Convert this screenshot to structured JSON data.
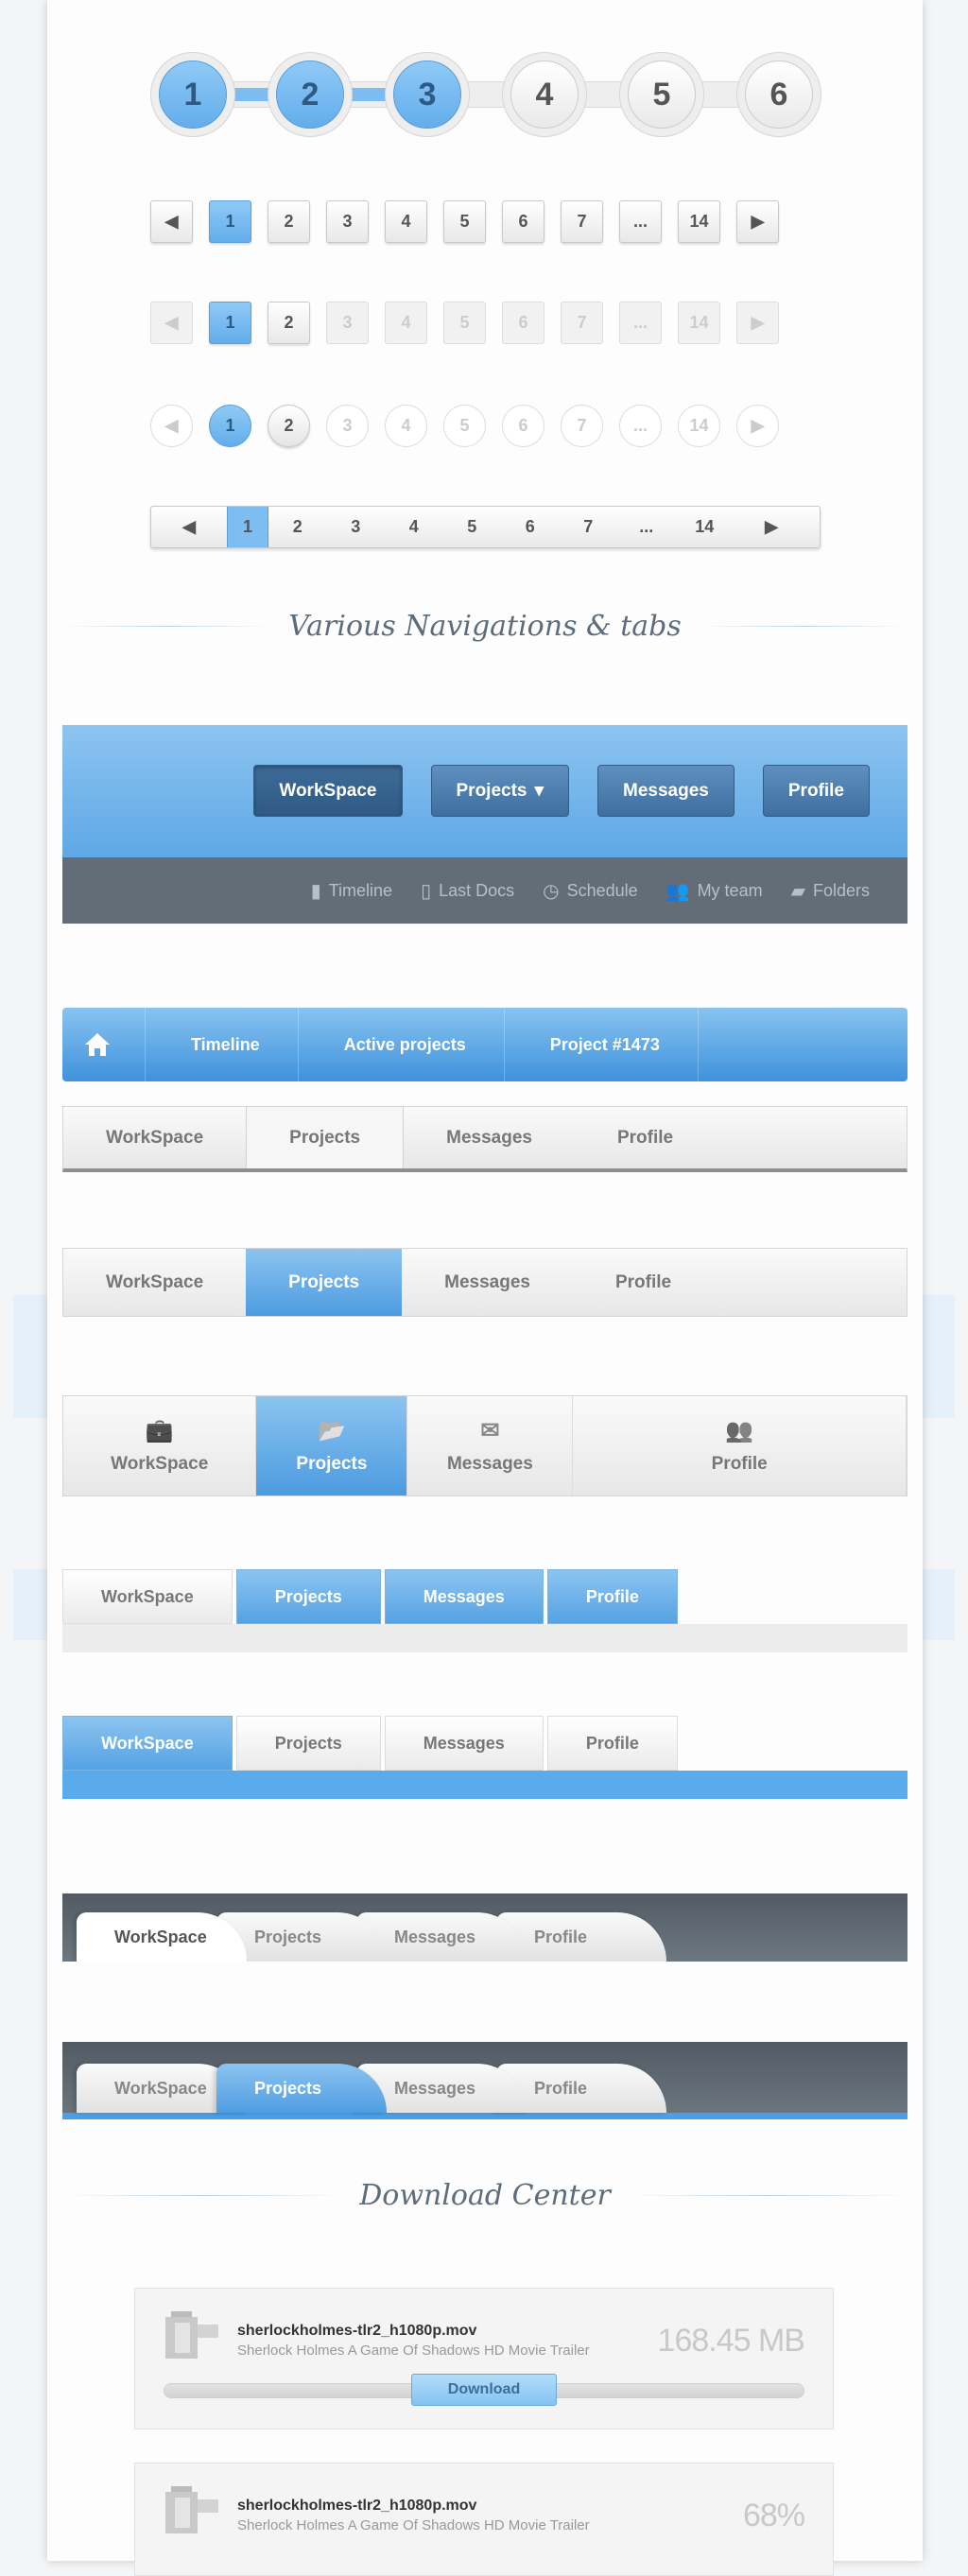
{
  "colors": {
    "accent": "#63adeb",
    "dark_bar": "#636d77",
    "text": "#555555"
  },
  "steps": {
    "items": [
      "1",
      "2",
      "3",
      "4",
      "5",
      "6"
    ],
    "completed": 3
  },
  "pagination": {
    "prev_icon": "triangle-left-icon",
    "next_icon": "triangle-right-icon",
    "prev": "◀",
    "next": "▶",
    "pages": [
      "1",
      "2",
      "3",
      "4",
      "5",
      "6",
      "7",
      "...",
      "14"
    ],
    "active": "1"
  },
  "section_nav": {
    "title": "Various Navigations & tabs"
  },
  "topnav": {
    "buttons": [
      "WorkSpace",
      "Projects",
      "Messages",
      "Profile"
    ],
    "dropdown_icon": "▾",
    "subitems": [
      {
        "label": "Timeline",
        "icon": "bar-chart-icon"
      },
      {
        "label": "Last Docs",
        "icon": "document-icon"
      },
      {
        "label": "Schedule",
        "icon": "clock-icon"
      },
      {
        "label": "My team",
        "icon": "users-icon"
      },
      {
        "label": "Folders",
        "icon": "folder-icon"
      }
    ]
  },
  "breadcrumb": {
    "home_icon": "home-icon",
    "items": [
      "Timeline",
      "Active projects",
      "Project #1473"
    ]
  },
  "tabs": [
    "WorkSpace",
    "Projects",
    "Messages",
    "Profile"
  ],
  "icon_tabs": [
    {
      "label": "WorkSpace",
      "icon": "briefcase-icon"
    },
    {
      "label": "Projects",
      "icon": "folder-open-icon"
    },
    {
      "label": "Messages",
      "icon": "envelope-icon"
    },
    {
      "label": "Profile",
      "icon": "users-icon"
    }
  ],
  "section_download": {
    "title": "Download Center"
  },
  "downloads": [
    {
      "file": "sherlockholmes-tlr2_h1080p.mov",
      "desc": "Sherlock Holmes A Game Of Shadows HD Movie Trailer",
      "size": "168.45 MB",
      "button": "Download"
    },
    {
      "file": "sherlockholmes-tlr2_h1080p.mov",
      "desc": "Sherlock Holmes A Game Of Shadows HD Movie Trailer",
      "progress": "68%"
    }
  ]
}
